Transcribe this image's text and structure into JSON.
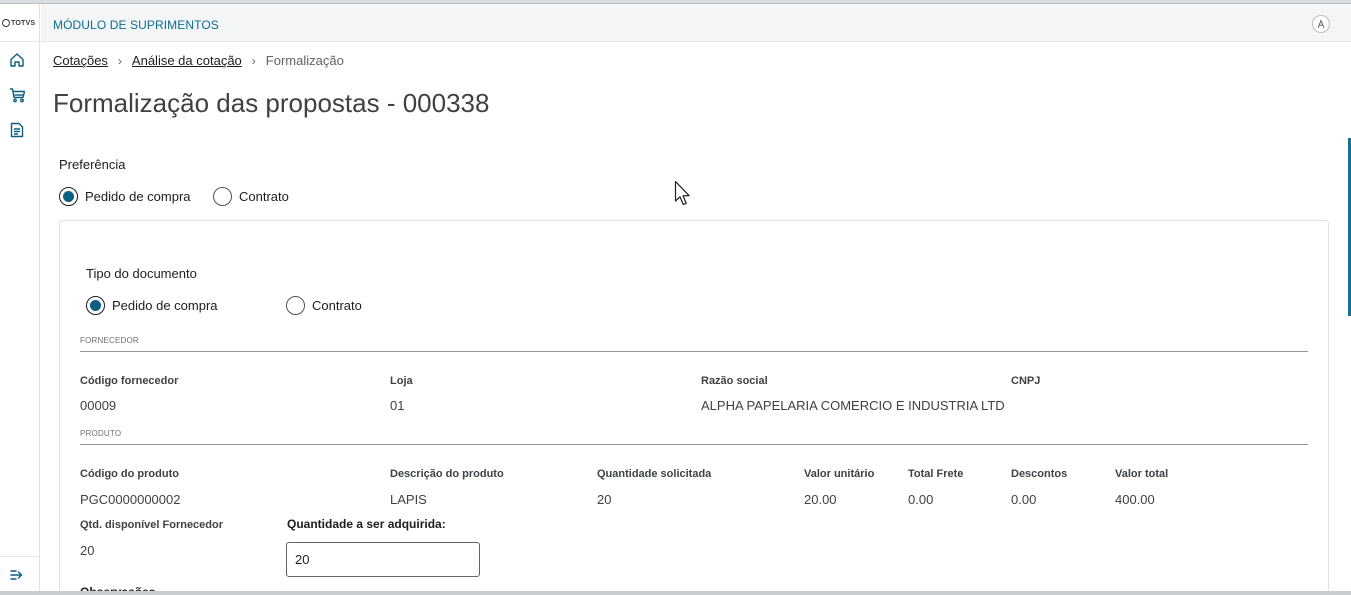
{
  "app": {
    "logo_text": "TOTVS",
    "module_title": "MÓDULO DE SUPRIMENTOS",
    "avatar_label": "A"
  },
  "sidebar": {
    "items": [
      {
        "icon": "home-icon"
      },
      {
        "icon": "cart-icon"
      },
      {
        "icon": "document-icon"
      }
    ],
    "collapse_icon": "collapse-menu-icon"
  },
  "breadcrumb": {
    "items": [
      "Cotações",
      "Análise da cotação"
    ],
    "current": "Formalização"
  },
  "page_title": "Formalização das propostas - 000338",
  "preferencia": {
    "label": "Preferência",
    "options": [
      "Pedido de compra",
      "Contrato"
    ],
    "selected": "Pedido de compra"
  },
  "tipo_documento": {
    "label": "Tipo do documento",
    "options": [
      "Pedido de compra",
      "Contrato"
    ],
    "selected": "Pedido de compra"
  },
  "fornecedor": {
    "section_label": "FORNECEDOR",
    "fields": [
      {
        "label": "Código fornecedor",
        "value": "00009"
      },
      {
        "label": "Loja",
        "value": "01"
      },
      {
        "label": "Razão social",
        "value": "ALPHA PAPELARIA COMERCIO E INDUSTRIA LTD"
      },
      {
        "label": "CNPJ",
        "value": ""
      }
    ]
  },
  "produto": {
    "section_label": "PRODUTO",
    "fields": [
      {
        "label": "Código do produto",
        "value": "PGC0000000002"
      },
      {
        "label": "Descrição do produto",
        "value": "LAPIS"
      },
      {
        "label": "Quantidade solicitada",
        "value": "20"
      },
      {
        "label": "Valor unitário",
        "value": "20.00"
      },
      {
        "label": "Total Frete",
        "value": "0.00"
      },
      {
        "label": "Descontos",
        "value": "0.00"
      },
      {
        "label": "Valor total",
        "value": "400.00"
      }
    ],
    "qtd_disponivel": {
      "label": "Qtd. disponível Fornecedor",
      "value": "20"
    },
    "quantidade_adquirida": {
      "label": "Quantidade a ser adquirida:",
      "value": "20"
    }
  },
  "observacoes_label": "Observações",
  "colors": {
    "accent": "#0c6d8e",
    "radio_selected": "#0c5f80",
    "scroll_thumb": "#1d6f93"
  }
}
